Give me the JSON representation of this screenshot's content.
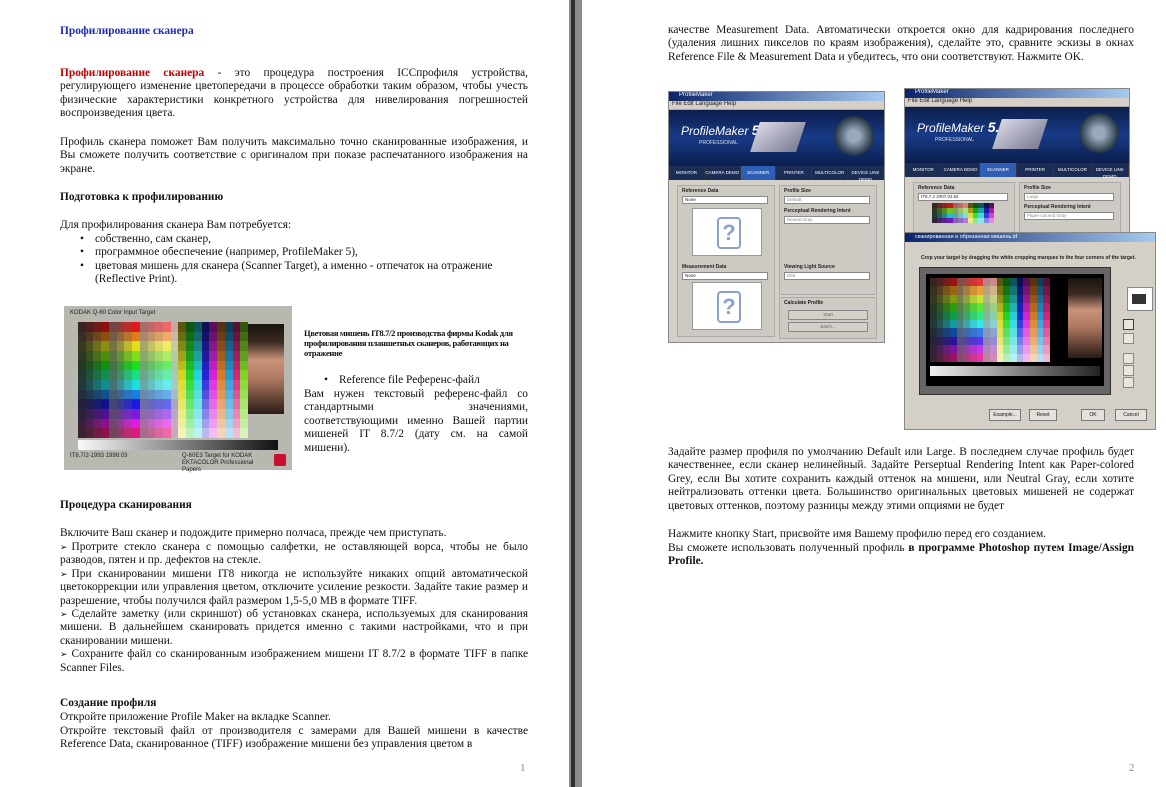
{
  "page1": {
    "title": "Профилирование сканера",
    "intro_term": "Профилирование сканера",
    "intro_rest": " - это процедура построения ICCпрофиля устройства, регулирующего изменение цветопередачи в процессе обработки таким образом, чтобы учесть физические характеристики конкретного устройства для нивелирования погрешностей воспроизведения цвета.",
    "para2": "Профиль сканера поможет Вам получить максимально точно сканированные изображения, и Вы сможете получить соответствие с оригиналом при показе распечатанного изображения на экране.",
    "heading_prep": "Подготовка к профилированию",
    "need_text": "Для профилирования сканера Вам потребуется:",
    "need_items": [
      "собственно, сам сканер,",
      "программное обеспечение (например, ProfileMaker 5),",
      "цветовая мишень для сканера (Scanner Target), а именно - отпечаток на отражение (Reflective Print)."
    ],
    "target_header": "KODAK Q-60 Color Input Target",
    "target_footer_left": "IT8.7/2-1993 1998:03",
    "target_footer_right": "Q-60E3 Target for KODAK EKTACOLOR Professional Papers",
    "caption": "Цветовая мишень IT8.7/2 производства фирмы Kodak для профилирования планшетных сканеров, работающих на отражение",
    "ref_item": "Reference file Референс-файл",
    "ref_desc": "Вам нужен текстовый референс-файл со стандартными значениями, соответствующими именно Вашей партии мишеней IT 8.7/2 (дату см. на самой мишени).",
    "heading_scan": "Процедура сканирования",
    "scan_intro": "Включите Ваш сканер и подождите примерно полчаса, прежде чем приступать.",
    "scan_steps": [
      "Протрите стекло сканера с помощью салфетки, не оставляющей ворса, чтобы не было разводов, пятен и пр. дефектов на стекле.",
      "При сканировании мишени IT8 никогда не используйте никаких опций автоматической цветокоррекции или управления цветом, отключите усиление резкости. Задайте такие размер и разрешение, чтобы получился файл размером 1,5-5,0 MB в формате TIFF.",
      "Сделайте заметку (или скриншот) об установках сканера, используемых для сканирования мишени. В дальнейшем сканировать придется именно с такими настройками, что и при сканировании мишени.",
      "Сохраните файл со сканированным изображением мишени IT 8.7/2 в формате TIFF в папке Scanner Files."
    ],
    "heading_create": "Создание профиля",
    "create_line1": "Откройте приложение Profile Maker на вкладке Scanner.",
    "create_line2": "Откройте текстовый файл от производителя с замерами для Вашей мишени в качестве Reference Data, сканированное (TIFF) изображение мишени без управления цветом в",
    "page_number": "1"
  },
  "page2": {
    "top_text": "качестве Measurement Data. Автоматически откроется окно для кадрирования последнего (удаления лишних пикселов по краям изображения), сделайте это, сравните эскизы в окнах Reference File & Measurement Data и убедитесь, что они соответствуют. Нажмите OK.",
    "app": {
      "window_title": "ProfileMaker",
      "menu": "File  Edit  Language  Help",
      "logo": "ProfileMaker",
      "version": "5.0",
      "edition": "PROFESSIONAL",
      "tabs": [
        "MONITOR",
        "CAMERA DEMO",
        "SCANNER",
        "PRINTER",
        "MULTICOLOR",
        "DEVICE LINK DEMO"
      ],
      "reference_label": "Reference Data",
      "reference_value_left": "None",
      "reference_value_right": "IT8.7.2 2007.03.txt",
      "measurement_label": "Measurement Data",
      "measurement_value": "None",
      "profile_size_label": "Profile Size",
      "profile_size_left": "Default",
      "profile_size_right": "Large",
      "rendering_label": "Perceptual Rendering Intent",
      "rendering_left": "Neutral Gray",
      "rendering_right": "Paper-colored Gray",
      "light_label": "Viewing Light Source",
      "light_value": "D50",
      "calc_label": "Calculate Profile",
      "start_label": "Start",
      "batch_label": "Batch..."
    },
    "crop": {
      "title": "сканированная и обрезанная мишень.tif",
      "instruction": "Crop your target by dragging the white cropping marquee to the four corners of the target.",
      "buttons": [
        "Example...",
        "Reset",
        "OK",
        "Cancel"
      ]
    },
    "para_size": "Задайте размер профиля по умолчанию Default или Large. В последнем случае профиль будет качественнее, если сканер нелинейный. Задайте Perseptual Rendering Intent как Paper-colored Grey, если Вы хотите сохранить каждый оттенок на мишени, или  Neutral Gray, если хотите нейтрализовать оттенки цвета. Большинство оригинальных цветовых мишеней не содержат цветовых оттенков, поэтому разницы между этими опциями не будет",
    "para_start": "Нажмите кнопку Start, присвойте имя Вашему профилю перед его созданием.",
    "para_use_start": "Вы сможете использовать полученный профиль ",
    "para_use_bold": "в программе Photoshop путем Image/Assign Profile.",
    "page_number": "2"
  },
  "colors": {
    "title_blue": "#1c2bb8",
    "term_red": "#c00000",
    "divider": "#2e2e2e"
  }
}
